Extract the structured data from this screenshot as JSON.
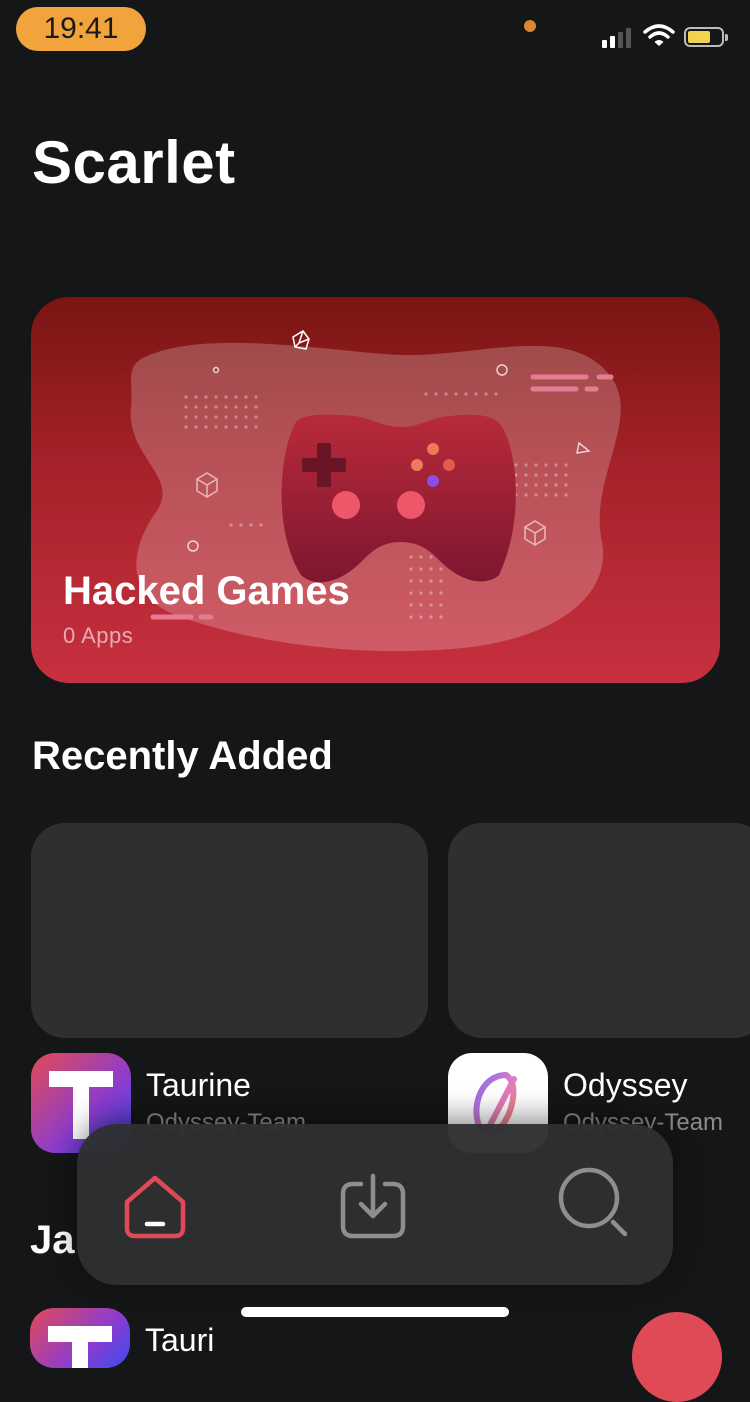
{
  "status_bar": {
    "time": "19:41"
  },
  "header": {
    "title": "Scarlet"
  },
  "featured": {
    "title": "Hacked Games",
    "subtitle": "0 Apps"
  },
  "recently_added": {
    "title": "Recently Added",
    "apps": [
      {
        "name": "Taurine",
        "developer": "Odyssey-Team"
      },
      {
        "name": "Odyssey",
        "developer": "Odyssey-Team"
      }
    ]
  },
  "next_section": {
    "title_partial": "Ja"
  },
  "next_row": {
    "name_partial": "Tauri"
  },
  "tabbar": {
    "tabs": [
      {
        "icon": "home-icon",
        "active": true
      },
      {
        "icon": "download-icon",
        "active": false
      },
      {
        "icon": "search-icon",
        "active": false
      }
    ]
  },
  "colors": {
    "accent": "#e04a57",
    "status_pill": "#f1a43c",
    "background": "#151617"
  }
}
